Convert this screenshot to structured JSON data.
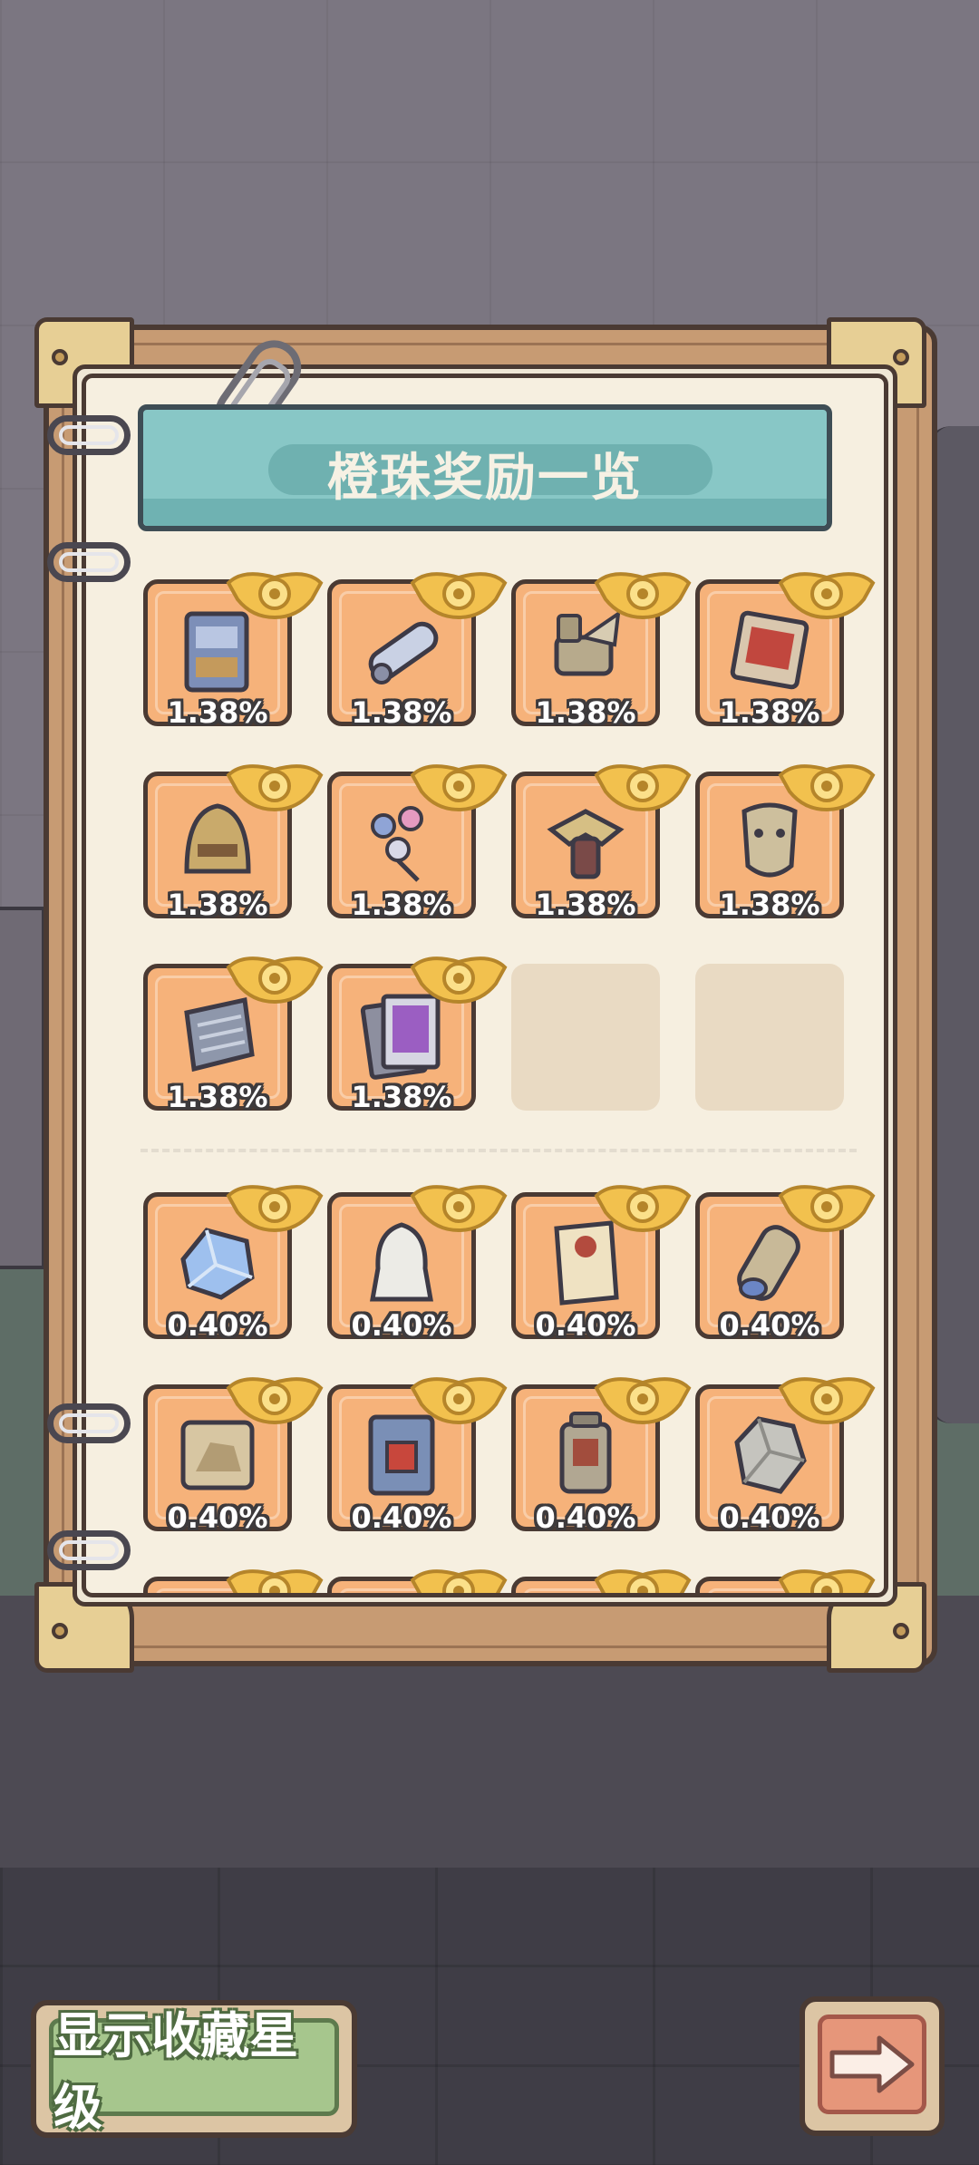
{
  "title": "橙珠奖励一览",
  "rows": [
    [
      {
        "item": "blue-book-icon",
        "percent": "1.38%"
      },
      {
        "item": "scroll-capsule-icon",
        "percent": "1.38%"
      },
      {
        "item": "winged-bull-statue-icon",
        "percent": "1.38%"
      },
      {
        "item": "red-card-icon",
        "percent": "1.38%"
      }
    ],
    [
      {
        "item": "golden-helmet-icon",
        "percent": "1.38%"
      },
      {
        "item": "flower-bouquet-icon",
        "percent": "1.38%"
      },
      {
        "item": "eagle-statue-icon",
        "percent": "1.38%"
      },
      {
        "item": "stone-mask-icon",
        "percent": "1.38%"
      }
    ],
    [
      {
        "item": "stone-tablet-icon",
        "percent": "1.38%"
      },
      {
        "item": "trading-card-icon",
        "percent": "1.38%"
      },
      {
        "item": "",
        "percent": ""
      },
      {
        "item": "",
        "percent": ""
      }
    ],
    [
      {
        "item": "blue-crystal-icon",
        "percent": "0.40%"
      },
      {
        "item": "white-veil-icon",
        "percent": "0.40%"
      },
      {
        "item": "parchment-icon",
        "percent": "0.40%"
      },
      {
        "item": "blue-cylinder-icon",
        "percent": "0.40%"
      }
    ],
    [
      {
        "item": "sphinx-tablet-icon",
        "percent": "0.40%"
      },
      {
        "item": "red-seal-book-icon",
        "percent": "0.40%"
      },
      {
        "item": "lantern-statue-icon",
        "percent": "0.40%"
      },
      {
        "item": "rock-fragment-icon",
        "percent": "0.40%"
      }
    ]
  ],
  "buttons": {
    "show_collection_stars": "显示收藏星级",
    "next_icon": "arrow-right-icon"
  },
  "colors": {
    "cell_orange": "#f6b27a",
    "banner_teal": "#88c7c6",
    "badge_gold": "#f2c14e"
  }
}
